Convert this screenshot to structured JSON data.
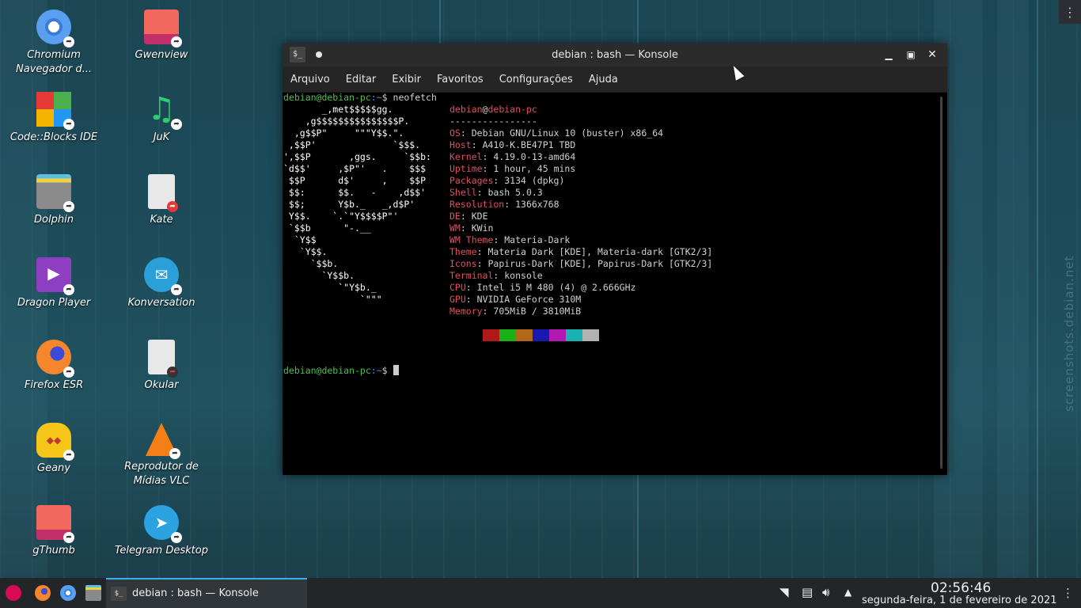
{
  "desktop": {
    "icons": [
      {
        "label": "Chromium Navegador d...",
        "icon": "chromium-icon"
      },
      {
        "label": "Gwenview",
        "icon": "gwenview-icon"
      },
      {
        "label": "Code::Blocks IDE",
        "icon": "codeblocks-icon"
      },
      {
        "label": "JuK",
        "icon": "juk-icon"
      },
      {
        "label": "Dolphin",
        "icon": "dolphin-icon"
      },
      {
        "label": "Kate",
        "icon": "kate-icon"
      },
      {
        "label": "Dragon Player",
        "icon": "dragon-player-icon"
      },
      {
        "label": "Konversation",
        "icon": "konversation-icon"
      },
      {
        "label": "Firefox ESR",
        "icon": "firefox-icon"
      },
      {
        "label": "Okular",
        "icon": "okular-icon"
      },
      {
        "label": "Geany",
        "icon": "geany-icon"
      },
      {
        "label": "Reprodutor de Mídias VLC",
        "icon": "vlc-icon"
      },
      {
        "label": "gThumb",
        "icon": "gthumb-icon"
      },
      {
        "label": "Telegram Desktop",
        "icon": "telegram-icon"
      }
    ],
    "watermark": "screenshots.debian.net"
  },
  "window": {
    "title": "debian : bash — Konsole",
    "menu": [
      "Arquivo",
      "Editar",
      "Exibir",
      "Favoritos",
      "Configurações",
      "Ajuda"
    ]
  },
  "terminal": {
    "prompt_user": "debian@debian-pc",
    "prompt_path": ":~",
    "prompt_symbol": "$",
    "command": "neofetch",
    "ascii_art": [
      "       _,met$$$$$gg.",
      "    ,g$$$$$$$$$$$$$$$P.",
      "  ,g$$P\"     \"\"\"Y$$.\".",
      " ,$$P'              `$$$.",
      "',$$P       ,ggs.     `$$b:",
      "`d$$'     ,$P\"'   .    $$$",
      " $$P      d$'     ,    $$P",
      " $$:      $$.   -    ,d$$'",
      " $$;      Y$b._   _,d$P'",
      " Y$$.    `.`\"Y$$$$P\"'",
      " `$$b      \"-.__",
      "  `Y$$",
      "   `Y$$.",
      "     `$$b.",
      "       `Y$$b.",
      "          `\"Y$b._",
      "              `\"\"\""
    ],
    "header": {
      "user": "debian",
      "at": "@",
      "host": "debian-pc",
      "underline": "----------------"
    },
    "info": [
      {
        "key": "OS",
        "value": "Debian GNU/Linux 10 (buster) x86_64"
      },
      {
        "key": "Host",
        "value": "A410-K.BE47P1 TBD"
      },
      {
        "key": "Kernel",
        "value": "4.19.0-13-amd64"
      },
      {
        "key": "Uptime",
        "value": "1 hour, 45 mins"
      },
      {
        "key": "Packages",
        "value": "3134 (dpkg)"
      },
      {
        "key": "Shell",
        "value": "bash 5.0.3"
      },
      {
        "key": "Resolution",
        "value": "1366x768"
      },
      {
        "key": "DE",
        "value": "KDE"
      },
      {
        "key": "WM",
        "value": "KWin"
      },
      {
        "key": "WM Theme",
        "value": "Materia-Dark"
      },
      {
        "key": "Theme",
        "value": "Materia Dark [KDE], Materia-dark [GTK2/3]"
      },
      {
        "key": "Icons",
        "value": "Papirus-Dark [KDE], Papirus-Dark [GTK2/3]"
      },
      {
        "key": "Terminal",
        "value": "konsole"
      },
      {
        "key": "CPU",
        "value": "Intel i5 M 480 (4) @ 2.666GHz"
      },
      {
        "key": "GPU",
        "value": "NVIDIA GeForce 310M"
      },
      {
        "key": "Memory",
        "value": "705MiB / 3810MiB"
      }
    ],
    "palette": [
      "#000000",
      "#b21818",
      "#18b218",
      "#b26818",
      "#1818b2",
      "#b218b2",
      "#18b2b2",
      "#b2b2b2"
    ]
  },
  "taskbar": {
    "launchers": [
      "debian-menu-icon",
      "firefox-icon",
      "chromium-icon",
      "dolphin-icon"
    ],
    "task_label": "debian : bash — Konsole",
    "tray": [
      "wifi-icon",
      "clipboard-icon",
      "volume-icon",
      "expand-tray-icon"
    ],
    "time": "02:56:46",
    "date": "segunda-feira, 1 de fevereiro de 2021"
  }
}
